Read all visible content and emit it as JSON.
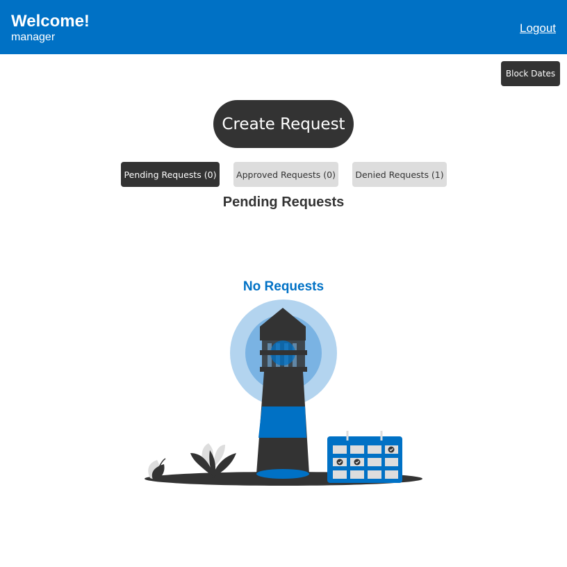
{
  "header": {
    "greeting": "Welcome!",
    "username": "manager",
    "logout_label": "Logout"
  },
  "toolbar": {
    "block_dates_label": "Block Dates"
  },
  "main": {
    "create_request_label": "Create Request",
    "tabs": [
      {
        "label": "Pending Requests (0)",
        "active": true
      },
      {
        "label": "Approved Requests (0)",
        "active": false
      },
      {
        "label": "Denied Requests (1)",
        "active": false
      }
    ],
    "section_title": "Pending Requests",
    "empty_state": {
      "title": "No Requests",
      "illustration": "lighthouse-calendar-illustration"
    }
  },
  "colors": {
    "brand": "#0071c5",
    "dark": "#333333",
    "tab_inactive": "#dddddd",
    "light_blue": "#b3d4ef"
  }
}
